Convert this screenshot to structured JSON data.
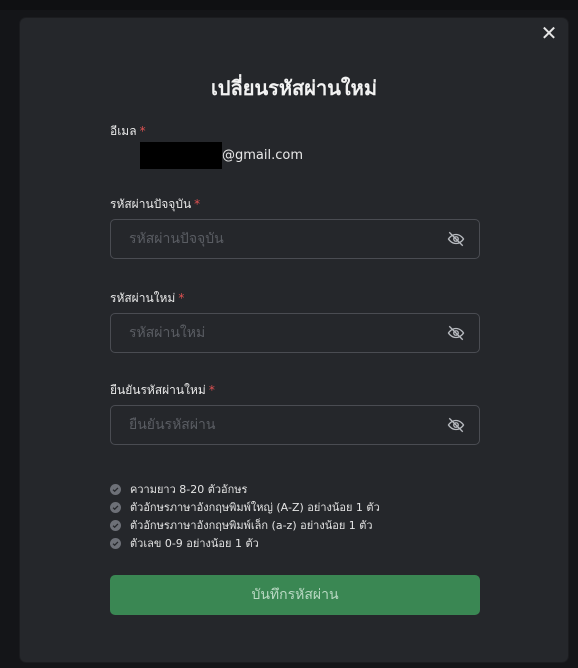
{
  "modal": {
    "title": "เปลี่ยนรหัสผ่านใหม่",
    "close_label": "✕"
  },
  "email": {
    "label": "อีเมล",
    "value_suffix": "@gmail.com"
  },
  "required_mark": "*",
  "current_password": {
    "label": "รหัสผ่านปัจจุบัน",
    "placeholder": "รหัสผ่านปัจจุบัน"
  },
  "new_password": {
    "label": "รหัสผ่านใหม่",
    "placeholder": "รหัสผ่านใหม่"
  },
  "confirm_password": {
    "label": "ยืนยันรหัสผ่านใหม่",
    "placeholder": "ยืนยันรหัสผ่าน"
  },
  "rules": [
    "ความยาว 8-20 ตัวอักษร",
    "ตัวอักษรภาษาอังกฤษพิมพ์ใหญ่ (A-Z) อย่างน้อย 1 ตัว",
    "ตัวอักษรภาษาอังกฤษพิมพ์เล็ก (a-z) อย่างน้อย 1 ตัว",
    "ตัวเลข 0-9 อย่างน้อย 1 ตัว"
  ],
  "save_button": "บันทึกรหัสผ่าน",
  "colors": {
    "accent": "#3a8753",
    "required": "#e05252",
    "background": "#25272b"
  },
  "icons": {
    "close": "close-icon",
    "eye_off": "eye-off-icon",
    "check": "check-circle-icon"
  }
}
